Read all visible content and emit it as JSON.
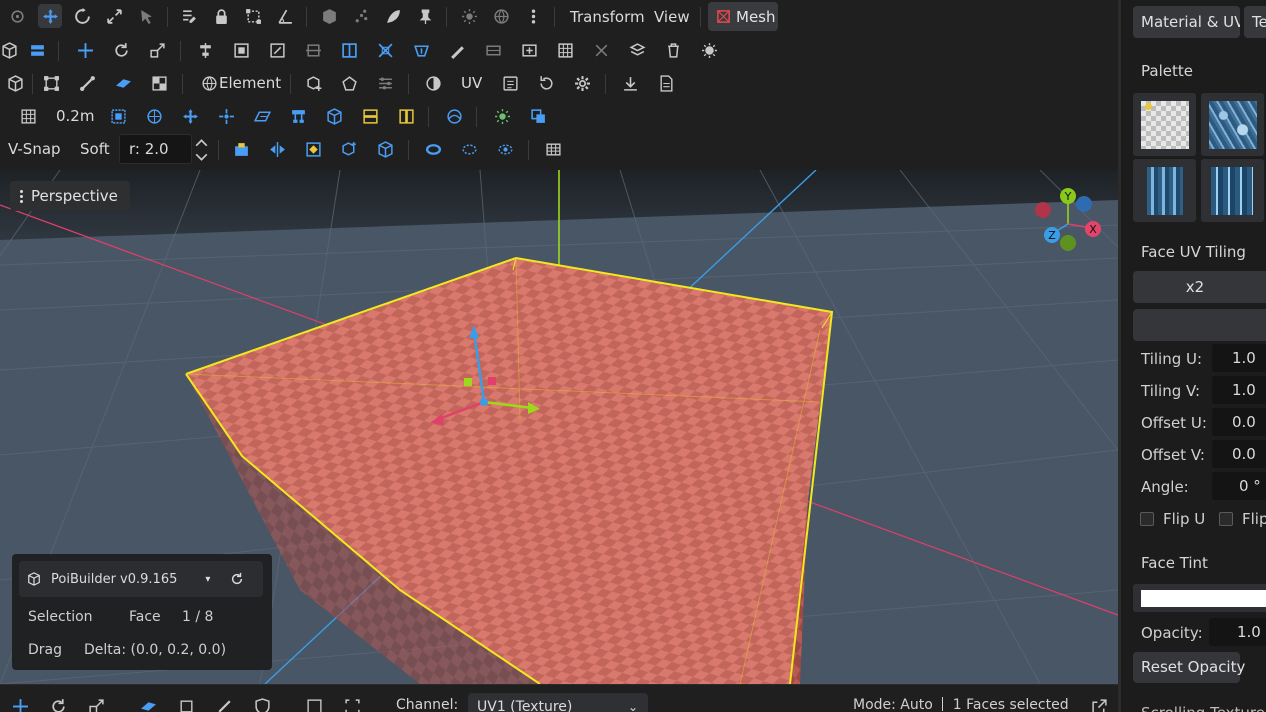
{
  "toolbar": {
    "menu_transform": "Transform",
    "menu_view": "View",
    "mesh_label": "Mesh",
    "element_label": "Element",
    "uv_label": "UV",
    "grid_size": "0.2m",
    "vsnap_label": "V-Snap",
    "soft_label": "Soft",
    "radius_value": "r: 2.0"
  },
  "viewport": {
    "view_label": "Perspective",
    "gizmo_axes": {
      "y": "Y",
      "x": "X",
      "z": "Z"
    },
    "colors": {
      "selection_outline": "#f2e81e",
      "face_checker_light": "#d9786c",
      "face_checker_dark": "#c2655b",
      "x_axis": "#e0406a",
      "z_axis": "#3a9de8",
      "y_axis": "#9ed81a"
    }
  },
  "info_panel": {
    "title": "PoiBuilder v0.9.165",
    "selection_label": "Selection",
    "selection_mode": "Face",
    "selection_count": "1 / 8",
    "drag_label": "Drag",
    "drag_delta": "Delta: (0.0, 0.2, 0.0)"
  },
  "bottombar": {
    "channel_label": "Channel:",
    "channel_value": "UV1 (Texture)",
    "mode_status": "Mode: Auto",
    "faces_status": "1 Faces selected"
  },
  "panel": {
    "tab_material": "Material & UV",
    "tab_texture": "Te",
    "palette_title": "Palette",
    "uv_tiling_title": "Face UV Tiling",
    "tiling_multiplier": "x2",
    "tiling_u_label": "Tiling U:",
    "tiling_u_value": "1.0",
    "tiling_v_label": "Tiling V:",
    "tiling_v_value": "1.0",
    "offset_u_label": "Offset U:",
    "offset_u_value": "0.0",
    "offset_v_label": "Offset V:",
    "offset_v_value": "0.0",
    "angle_label": "Angle:",
    "angle_value": "0 °",
    "flip_u_label": "Flip U",
    "flip_v_label": "Flip",
    "face_tint_title": "Face Tint",
    "opacity_label": "Opacity:",
    "opacity_value": "1.0",
    "reset_opacity": "Reset Opacity",
    "scrolled_off_title": "Scrolling Texture"
  },
  "accent_colors": {
    "blue": "#4a9df5",
    "mesh_red": "#e5484d",
    "yellow": "#e8c83a"
  }
}
